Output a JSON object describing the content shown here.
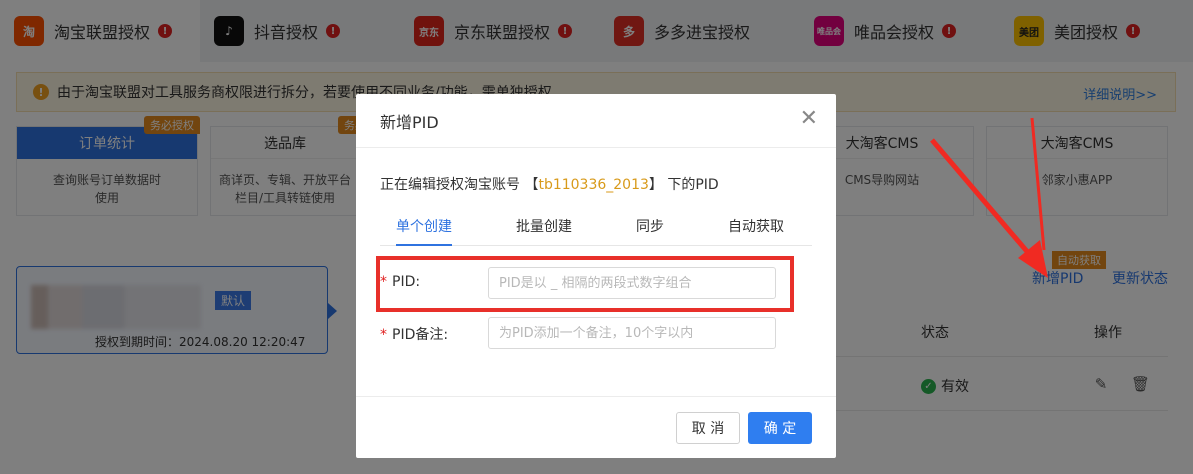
{
  "platform_tabs": [
    {
      "label": "淘宝联盟授权",
      "logo": "淘",
      "color": "#ff5000",
      "warn": "!"
    },
    {
      "label": "抖音授权",
      "logo": "♪",
      "color": "#111111",
      "warn": "!"
    },
    {
      "label": "京东联盟授权",
      "logo": "京东",
      "color": "#e1251b",
      "warn": "!"
    },
    {
      "label": "多多进宝授权",
      "logo": "多",
      "color": "#e02e24",
      "warn": ""
    },
    {
      "label": "唯品会授权",
      "logo": "唯品会",
      "color": "#e4007f",
      "warn": "!"
    },
    {
      "label": "美团授权",
      "logo": "美团",
      "color": "#ffc300",
      "warn": "!"
    }
  ],
  "notice": {
    "text": "由于淘宝联盟对工具服务商权限进行拆分，若要使用不同业务/功能，需单独授权",
    "more": "详细说明>>"
  },
  "features": [
    {
      "title": "订单统计",
      "desc1": "查询账号订单数据时",
      "desc2": "使用",
      "badge": "务必授权"
    },
    {
      "title": "选品库",
      "desc1": "商详页、专辑、开放平台",
      "desc2": "栏目/工具转链使用",
      "badge": "务必"
    },
    {
      "title": "大淘客CMS",
      "desc1": "CMS导购网站",
      "desc2": ""
    },
    {
      "title": "大淘客CMS",
      "desc1": "邻家小惠APP",
      "desc2": ""
    }
  ],
  "account": {
    "default_label": "默认",
    "expire": "授权到期时间：2024.08.20 12:20:47"
  },
  "right_panel": {
    "auto_badge": "自动获取",
    "add_pid": "新增PID",
    "refresh": "更新状态",
    "col_status": "状态",
    "col_action": "操作",
    "row_status": "有效"
  },
  "modal": {
    "title": "新增PID",
    "subtitle_prefix": "正在编辑授权淘宝账号 【",
    "account": "tb110336_2013",
    "subtitle_suffix": "】 下的PID",
    "tabs": [
      "单个创建",
      "批量创建",
      "同步",
      "自动获取"
    ],
    "pid_label": "PID",
    "pid_placeholder": "PID是以 _ 相隔的两段式数字组合",
    "note_label": "PID备注",
    "note_placeholder": "为PID添加一个备注，10个字以内",
    "cancel": "取 消",
    "confirm": "确 定"
  },
  "colors": {
    "primary": "#2f73e0",
    "warning": "#e58a1e",
    "highlight": "#e8302a"
  }
}
